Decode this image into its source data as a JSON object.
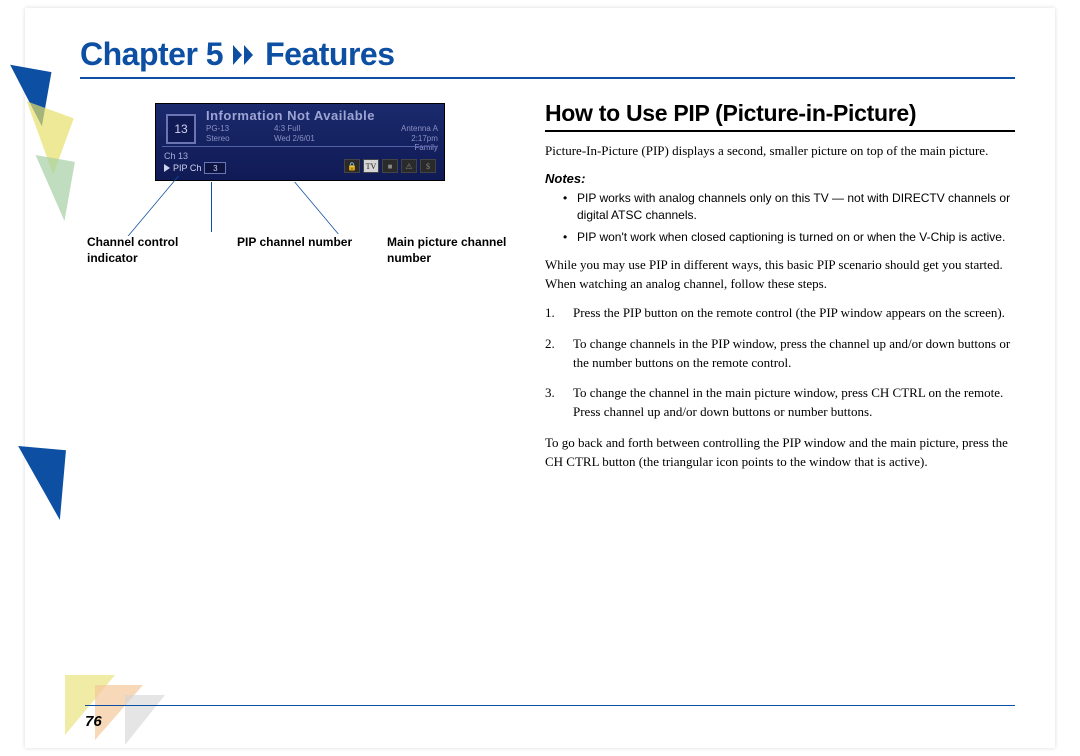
{
  "header": {
    "chapter_label": "Chapter 5",
    "chapter_name": "Features"
  },
  "figure": {
    "channel_box": "13",
    "info_title": "Information Not Available",
    "rating": "PG-13",
    "audio": "Stereo",
    "aspect": "4:3 Full",
    "date": "Wed 2/6/01",
    "antenna": "Antenna A",
    "time": "2:17pm",
    "genre": "Family",
    "ch_label": "Ch 13",
    "pip_tri_label": "PIP Ch",
    "pip_num": "3",
    "tv_icon": "TV",
    "callouts": {
      "c1": "Channel control indicator",
      "c2": "PIP channel number",
      "c3": "Main picture channel number"
    }
  },
  "content": {
    "title": "How to Use PIP (Picture-in-Picture)",
    "intro": "Picture-In-Picture (PIP) displays a second, smaller picture on top of the main picture.",
    "notes_label": "Notes:",
    "notes": [
      "PIP works with analog channels only on this TV — not with DIRECTV channels or digital ATSC channels.",
      "PIP won't work when closed captioning is turned on or when the V-Chip is active."
    ],
    "lead": "While you may use PIP in different ways, this basic PIP scenario should get you started. When watching an analog channel, follow these steps.",
    "steps": [
      "Press the PIP button on the remote control (the PIP window appears on the screen).",
      "To change channels in the PIP window, press the channel up and/or down buttons or the number buttons on the remote control.",
      "To change the channel in the main picture window, press CH CTRL on the remote. Press channel up and/or down buttons or number buttons."
    ],
    "outro": "To go back and forth between controlling the PIP window and the main picture, press the CH CTRL button (the triangular icon points to the window that is active)."
  },
  "footer": {
    "page": "76"
  }
}
